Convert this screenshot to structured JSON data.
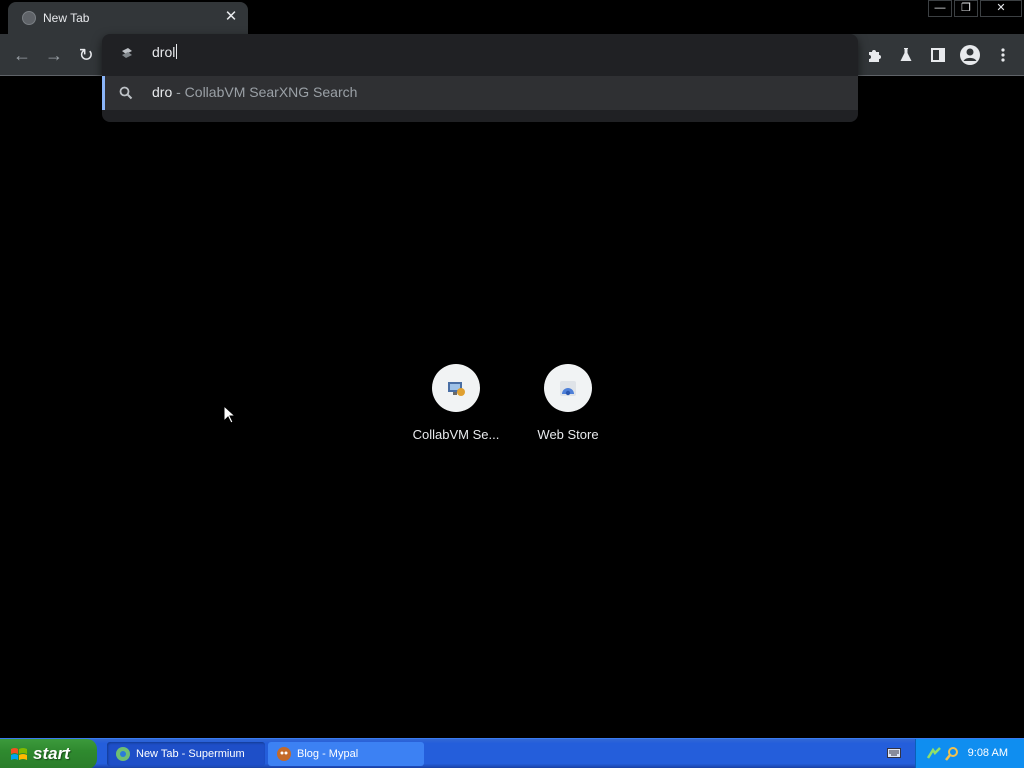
{
  "browser": {
    "tab": {
      "title": "New Tab",
      "close_glyph": "✕"
    },
    "window_controls": {
      "minimize": "—",
      "restore": "❐",
      "close": "✕"
    },
    "nav": {
      "back_glyph": "←",
      "forward_glyph": "→",
      "reload_glyph": "↻"
    },
    "omnibox": {
      "input_value": "drol",
      "suggestion": {
        "query": "dro",
        "description": " - CollabVM SearXNG Search"
      }
    },
    "toolbar_icons": [
      "puzzle-icon",
      "flask-icon",
      "side-panel-icon",
      "profile-icon",
      "menu-icon"
    ],
    "accent_color": "#8ab4f8"
  },
  "ntp": {
    "shortcuts": [
      {
        "label": "CollabVM Se...",
        "icon": "collabvm-icon"
      },
      {
        "label": "Web Store",
        "icon": "web-store-icon"
      }
    ]
  },
  "taskbar": {
    "start_label": "start",
    "tasks": [
      {
        "label": "New Tab - Supermium",
        "active": true
      },
      {
        "label": "Blog - Mypal",
        "active": false
      }
    ],
    "clock": "9:08 AM"
  }
}
